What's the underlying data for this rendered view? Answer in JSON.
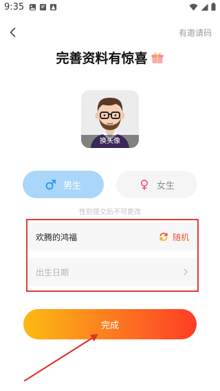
{
  "status_bar": {
    "time": "9:35",
    "left_icons": [
      "photo-icon",
      "notification-icon",
      "app-icon"
    ],
    "right_icons": [
      "wifi-icon",
      "signal-icon",
      "battery-icon"
    ]
  },
  "header": {
    "back_icon": "back-arrow-icon",
    "invite_label": "有邀请码"
  },
  "page": {
    "title": "完善资料有惊喜",
    "title_icon": "gift-icon"
  },
  "avatar": {
    "change_label": "换头像"
  },
  "gender": {
    "male_label": "男生",
    "female_label": "女生",
    "selected": "male",
    "note": "性别提交后不可更改"
  },
  "form": {
    "nickname_value": "欢腾的鸿福",
    "random_label": "随机",
    "birth_placeholder": "出生日期"
  },
  "submit": {
    "label": "完成"
  },
  "colors": {
    "accent_red": "#e53935",
    "male_selected": "#a9d6f9",
    "button_gradient_start": "#fbba13",
    "button_gradient_end": "#ff3c26",
    "random_text": "#f05533"
  }
}
